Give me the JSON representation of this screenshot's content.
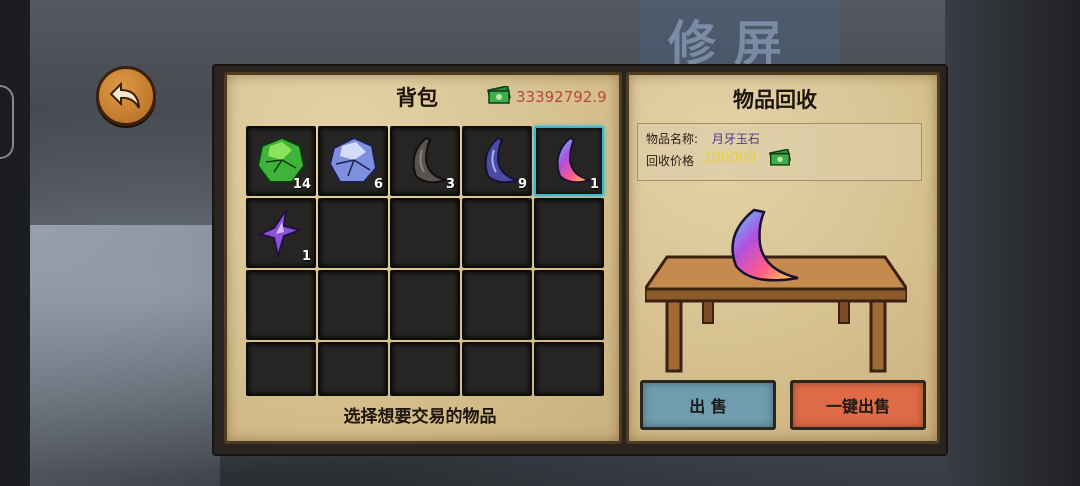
{
  "background": {
    "sign_text": "修屏"
  },
  "nav": {
    "back_icon": "back-arrow-icon"
  },
  "bag": {
    "title": "背包",
    "money": "33392792.9",
    "hint": "选择想要交易的物品",
    "slots": [
      {
        "item": "green-ore",
        "qty": "14",
        "selected": false
      },
      {
        "item": "blue-ore",
        "qty": "6",
        "selected": false
      },
      {
        "item": "dark-moon-stone",
        "qty": "3",
        "selected": false
      },
      {
        "item": "purple-moon-stone",
        "qty": "9",
        "selected": false
      },
      {
        "item": "rainbow-moon-jade",
        "qty": "1",
        "selected": true
      },
      {
        "item": "purple-star-shard",
        "qty": "1",
        "selected": false
      }
    ]
  },
  "recycle": {
    "title": "物品回收",
    "name_label": "物品名称:",
    "name_value": "月牙玉石",
    "price_label": "回收价格",
    "price_value": "100000",
    "sell_label": "出 售",
    "sell_all_label": "一键出售"
  },
  "colors": {
    "panel": "#d9c69a",
    "selected_border": "#38b8d2",
    "sell": "#6f9caf",
    "sell_all": "#de6b46",
    "money": "#b6483a"
  }
}
